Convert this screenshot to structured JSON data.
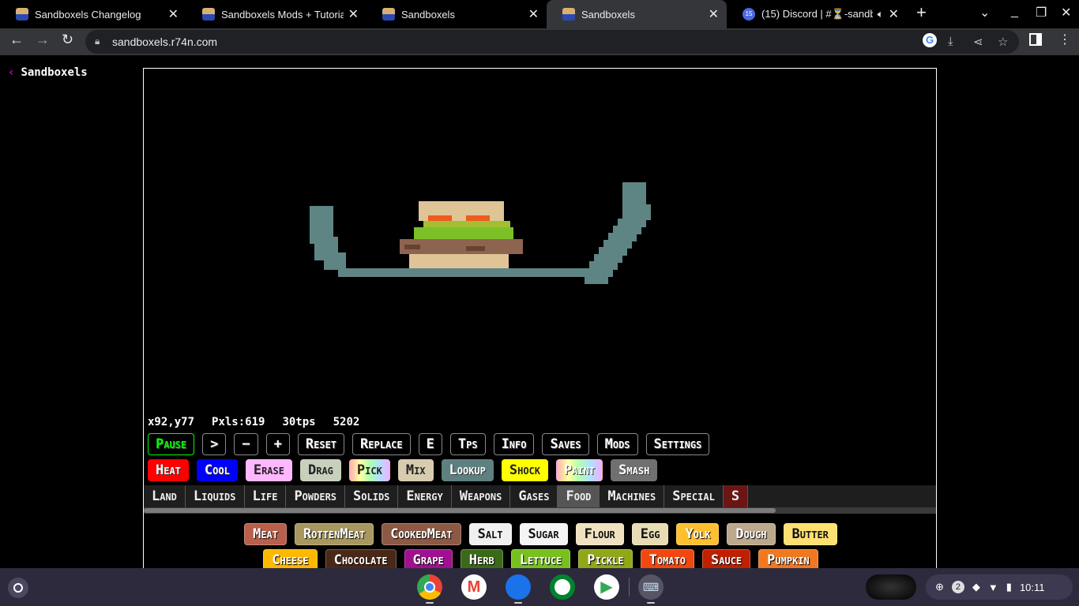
{
  "browser": {
    "tabs": [
      {
        "title": "Sandboxels Changelog",
        "active": false
      },
      {
        "title": "Sandboxels Mods + Tutorial",
        "active": false
      },
      {
        "title": "Sandboxels",
        "active": false
      },
      {
        "title": "Sandboxels",
        "active": true
      },
      {
        "title": "(15) Discord | #⏳-sandbo",
        "active": false,
        "badge": "15",
        "audio": true
      }
    ],
    "url": "sandboxels.r74n.com",
    "icons": [
      "back-icon",
      "forward-icon",
      "reload-icon",
      "lock-icon",
      "google-icon",
      "install-icon",
      "share-icon",
      "star-icon",
      "side-panel-icon",
      "menu-icon"
    ]
  },
  "page": {
    "back_label": "Sandboxels",
    "stats": {
      "coords": "x92,y77",
      "pixels": "Pxls:619",
      "tps": "30tps",
      "ticks": "5202"
    },
    "controls": [
      "Pause",
      ">",
      "−",
      "+",
      "Reset",
      "Replace",
      "E",
      "Tps",
      "Info",
      "Saves",
      "Mods",
      "Settings"
    ],
    "tools": [
      {
        "label": "Heat",
        "color": "#ff0000"
      },
      {
        "label": "Cool",
        "color": "#0000ff"
      },
      {
        "label": "Erase",
        "color": "#ffb8ff"
      },
      {
        "label": "Drag",
        "color": "#c8d0bc"
      },
      {
        "label": "Pick",
        "color": "#ffd0f0"
      },
      {
        "label": "Mix",
        "color": "#d8ccb0"
      },
      {
        "label": "Lookup",
        "color": "#5e8080"
      },
      {
        "label": "Shock",
        "color": "#ffff00"
      },
      {
        "label": "Paint",
        "color": "#d08080"
      },
      {
        "label": "Smash",
        "color": "#707070"
      }
    ],
    "categories": [
      "Land",
      "Liquids",
      "Life",
      "Powders",
      "Solids",
      "Energy",
      "Weapons",
      "Gases",
      "Food",
      "Machines",
      "Special",
      "S"
    ],
    "active_category": "Food",
    "elements_row1": [
      {
        "label": "Meat",
        "color": "#b8604c"
      },
      {
        "label": "RottenMeat",
        "color": "#a89860"
      },
      {
        "label": "CookedMeat",
        "color": "#8c5a44"
      },
      {
        "label": "Salt",
        "color": "#f0f0f0"
      },
      {
        "label": "Sugar",
        "color": "#f4f4f4"
      },
      {
        "label": "Flour",
        "color": "#f0e2c0"
      },
      {
        "label": "Egg",
        "color": "#e8dcb4"
      },
      {
        "label": "Yolk",
        "color": "#ffc030"
      },
      {
        "label": "Dough",
        "color": "#bca88c"
      },
      {
        "label": "Butter",
        "color": "#ffe070"
      }
    ],
    "elements_row2": [
      {
        "label": "Cheese",
        "color": "#ffb800"
      },
      {
        "label": "Chocolate",
        "color": "#4a2818"
      },
      {
        "label": "Grape",
        "color": "#a01090"
      },
      {
        "label": "Herb",
        "color": "#3a6a18"
      },
      {
        "label": "Lettuce",
        "color": "#78c020"
      },
      {
        "label": "Pickle",
        "color": "#90a818"
      },
      {
        "label": "Tomato",
        "color": "#f04810"
      },
      {
        "label": "Sauce",
        "color": "#c02000"
      },
      {
        "label": "Pumpkin",
        "color": "#f07820"
      }
    ]
  },
  "taskbar": {
    "apps": [
      "chrome-icon",
      "gmail-icon",
      "files-icon",
      "meet-icon",
      "play-store-icon",
      "keyboard-app-icon"
    ],
    "notifications": "2",
    "time": "10:11"
  }
}
